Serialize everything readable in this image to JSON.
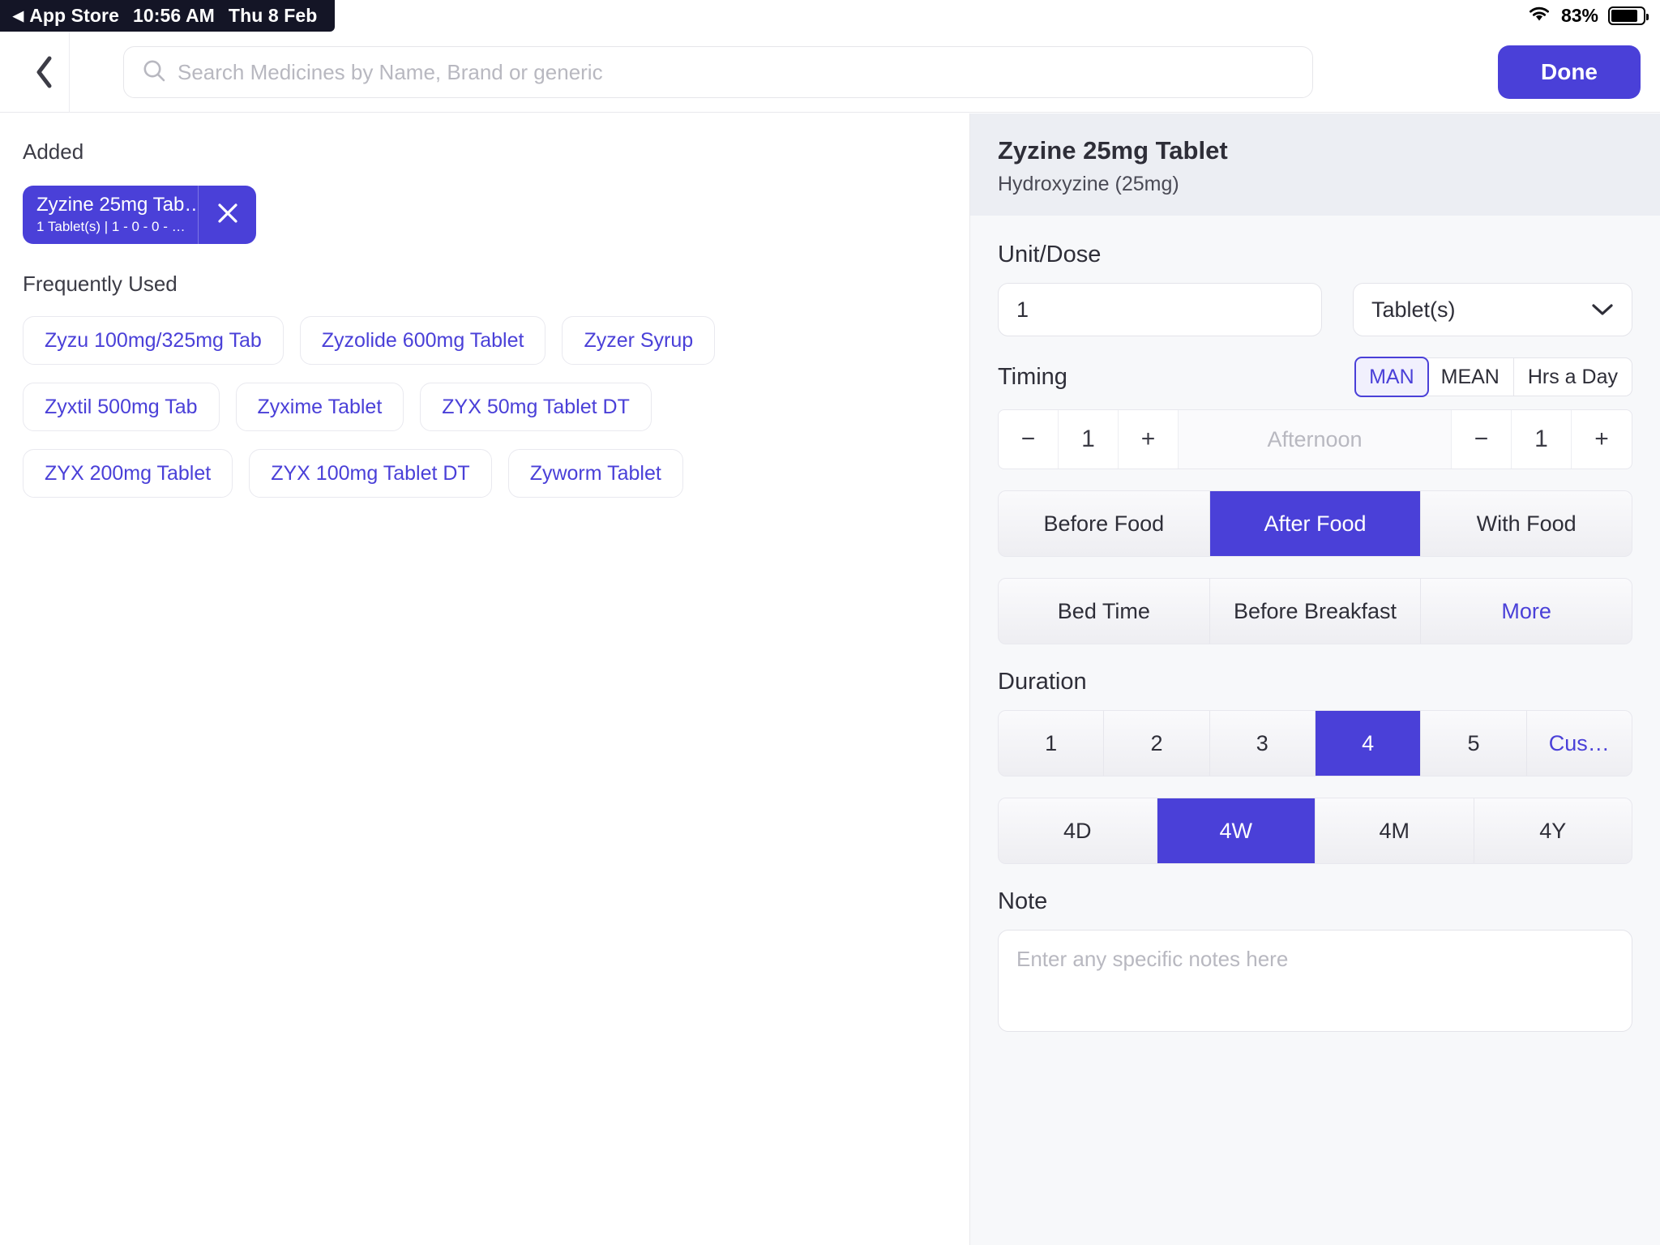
{
  "status_bar": {
    "back_app_label": "App Store",
    "back_triangle": "◀",
    "time": "10:56 AM",
    "date": "Thu 8 Feb",
    "wifi_icon": "wifi-icon",
    "battery_percent": "83%",
    "battery_icon": "battery-icon"
  },
  "top_bar": {
    "back_icon": "chevron-left-icon",
    "search": {
      "icon": "search-icon",
      "placeholder": "Search Medicines by Name, Brand or generic",
      "value": ""
    },
    "done_label": "Done"
  },
  "left_pane": {
    "added_label": "Added",
    "added_items": [
      {
        "name": "Zyzine 25mg Tab…",
        "detail": "1 Tablet(s) | 1 - 0 - 0 - …",
        "remove_icon": "close-icon"
      }
    ],
    "frequently_used_label": "Frequently Used",
    "frequently_used": [
      [
        "Zyzu 100mg/325mg Tab",
        "Zyzolide 600mg Tablet",
        "Zyzer Syrup"
      ],
      [
        "Zyxtil 500mg Tab",
        "Zyxime Tablet",
        "ZYX 50mg Tablet DT"
      ],
      [
        "ZYX 200mg Tablet",
        "ZYX 100mg Tablet DT",
        "Zyworm Tablet"
      ]
    ]
  },
  "right_pane": {
    "title": "Zyzine 25mg Tablet",
    "subtitle": "Hydroxyzine (25mg)",
    "unit_dose": {
      "label": "Unit/Dose",
      "value": "1",
      "unit_selected": "Tablet(s)",
      "chevron_icon": "chevron-down-icon"
    },
    "timing": {
      "label": "Timing",
      "modes": [
        {
          "label": "MAN",
          "selected": true
        },
        {
          "label": "MEAN",
          "selected": false
        },
        {
          "label": "Hrs a Day",
          "selected": false
        }
      ],
      "stepper_left": {
        "minus": "−",
        "value": "1",
        "plus": "+"
      },
      "middle_placeholder": "Afternoon",
      "stepper_right": {
        "minus": "−",
        "value": "1",
        "plus": "+"
      },
      "food_options": [
        {
          "label": "Before Food",
          "selected": false
        },
        {
          "label": "After Food",
          "selected": true
        },
        {
          "label": "With Food",
          "selected": false
        }
      ],
      "extra_options": [
        {
          "label": "Bed Time",
          "selected": false,
          "link": false
        },
        {
          "label": "Before Breakfast",
          "selected": false,
          "link": false
        },
        {
          "label": "More",
          "selected": false,
          "link": true
        }
      ]
    },
    "duration": {
      "label": "Duration",
      "counts": [
        {
          "label": "1",
          "selected": false,
          "link": false
        },
        {
          "label": "2",
          "selected": false,
          "link": false
        },
        {
          "label": "3",
          "selected": false,
          "link": false
        },
        {
          "label": "4",
          "selected": true,
          "link": false
        },
        {
          "label": "5",
          "selected": false,
          "link": false
        },
        {
          "label": "Cus…",
          "selected": false,
          "link": true
        }
      ],
      "units": [
        {
          "label": "4D",
          "selected": false
        },
        {
          "label": "4W",
          "selected": true
        },
        {
          "label": "4M",
          "selected": false
        },
        {
          "label": "4Y",
          "selected": false
        }
      ]
    },
    "note": {
      "label": "Note",
      "placeholder": "Enter any specific notes here",
      "value": ""
    }
  },
  "colors": {
    "accent": "#4a40d8",
    "accent_soft": "#f1f0fd",
    "panel_bg": "#f7f8fa",
    "panel_header_bg": "#eceef3",
    "status_bar_bg": "#141526"
  }
}
